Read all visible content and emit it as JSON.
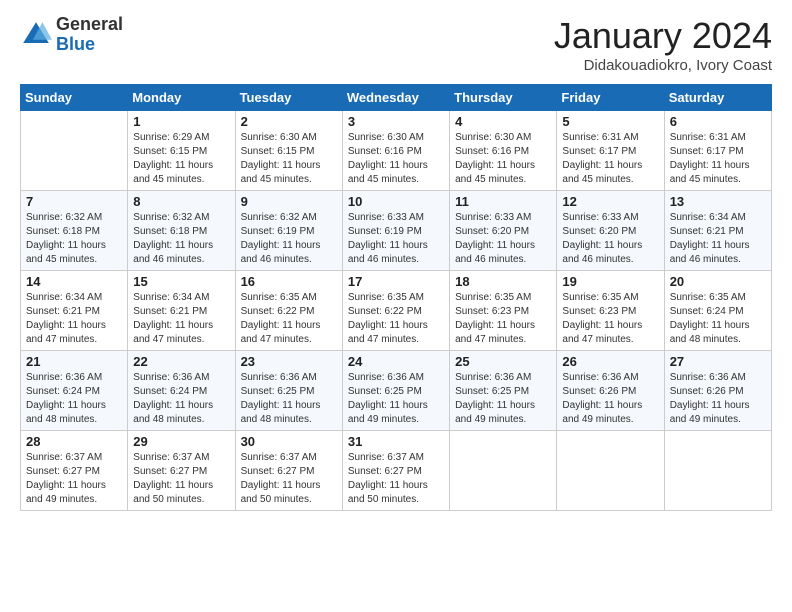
{
  "logo": {
    "general": "General",
    "blue": "Blue"
  },
  "header": {
    "month": "January 2024",
    "location": "Didakouadiokro, Ivory Coast"
  },
  "weekdays": [
    "Sunday",
    "Monday",
    "Tuesday",
    "Wednesday",
    "Thursday",
    "Friday",
    "Saturday"
  ],
  "weeks": [
    [
      {
        "day": "",
        "info": ""
      },
      {
        "day": "1",
        "info": "Sunrise: 6:29 AM\nSunset: 6:15 PM\nDaylight: 11 hours\nand 45 minutes."
      },
      {
        "day": "2",
        "info": "Sunrise: 6:30 AM\nSunset: 6:15 PM\nDaylight: 11 hours\nand 45 minutes."
      },
      {
        "day": "3",
        "info": "Sunrise: 6:30 AM\nSunset: 6:16 PM\nDaylight: 11 hours\nand 45 minutes."
      },
      {
        "day": "4",
        "info": "Sunrise: 6:30 AM\nSunset: 6:16 PM\nDaylight: 11 hours\nand 45 minutes."
      },
      {
        "day": "5",
        "info": "Sunrise: 6:31 AM\nSunset: 6:17 PM\nDaylight: 11 hours\nand 45 minutes."
      },
      {
        "day": "6",
        "info": "Sunrise: 6:31 AM\nSunset: 6:17 PM\nDaylight: 11 hours\nand 45 minutes."
      }
    ],
    [
      {
        "day": "7",
        "info": "Sunrise: 6:32 AM\nSunset: 6:18 PM\nDaylight: 11 hours\nand 45 minutes."
      },
      {
        "day": "8",
        "info": "Sunrise: 6:32 AM\nSunset: 6:18 PM\nDaylight: 11 hours\nand 46 minutes."
      },
      {
        "day": "9",
        "info": "Sunrise: 6:32 AM\nSunset: 6:19 PM\nDaylight: 11 hours\nand 46 minutes."
      },
      {
        "day": "10",
        "info": "Sunrise: 6:33 AM\nSunset: 6:19 PM\nDaylight: 11 hours\nand 46 minutes."
      },
      {
        "day": "11",
        "info": "Sunrise: 6:33 AM\nSunset: 6:20 PM\nDaylight: 11 hours\nand 46 minutes."
      },
      {
        "day": "12",
        "info": "Sunrise: 6:33 AM\nSunset: 6:20 PM\nDaylight: 11 hours\nand 46 minutes."
      },
      {
        "day": "13",
        "info": "Sunrise: 6:34 AM\nSunset: 6:21 PM\nDaylight: 11 hours\nand 46 minutes."
      }
    ],
    [
      {
        "day": "14",
        "info": "Sunrise: 6:34 AM\nSunset: 6:21 PM\nDaylight: 11 hours\nand 47 minutes."
      },
      {
        "day": "15",
        "info": "Sunrise: 6:34 AM\nSunset: 6:21 PM\nDaylight: 11 hours\nand 47 minutes."
      },
      {
        "day": "16",
        "info": "Sunrise: 6:35 AM\nSunset: 6:22 PM\nDaylight: 11 hours\nand 47 minutes."
      },
      {
        "day": "17",
        "info": "Sunrise: 6:35 AM\nSunset: 6:22 PM\nDaylight: 11 hours\nand 47 minutes."
      },
      {
        "day": "18",
        "info": "Sunrise: 6:35 AM\nSunset: 6:23 PM\nDaylight: 11 hours\nand 47 minutes."
      },
      {
        "day": "19",
        "info": "Sunrise: 6:35 AM\nSunset: 6:23 PM\nDaylight: 11 hours\nand 47 minutes."
      },
      {
        "day": "20",
        "info": "Sunrise: 6:35 AM\nSunset: 6:24 PM\nDaylight: 11 hours\nand 48 minutes."
      }
    ],
    [
      {
        "day": "21",
        "info": "Sunrise: 6:36 AM\nSunset: 6:24 PM\nDaylight: 11 hours\nand 48 minutes."
      },
      {
        "day": "22",
        "info": "Sunrise: 6:36 AM\nSunset: 6:24 PM\nDaylight: 11 hours\nand 48 minutes."
      },
      {
        "day": "23",
        "info": "Sunrise: 6:36 AM\nSunset: 6:25 PM\nDaylight: 11 hours\nand 48 minutes."
      },
      {
        "day": "24",
        "info": "Sunrise: 6:36 AM\nSunset: 6:25 PM\nDaylight: 11 hours\nand 49 minutes."
      },
      {
        "day": "25",
        "info": "Sunrise: 6:36 AM\nSunset: 6:25 PM\nDaylight: 11 hours\nand 49 minutes."
      },
      {
        "day": "26",
        "info": "Sunrise: 6:36 AM\nSunset: 6:26 PM\nDaylight: 11 hours\nand 49 minutes."
      },
      {
        "day": "27",
        "info": "Sunrise: 6:36 AM\nSunset: 6:26 PM\nDaylight: 11 hours\nand 49 minutes."
      }
    ],
    [
      {
        "day": "28",
        "info": "Sunrise: 6:37 AM\nSunset: 6:27 PM\nDaylight: 11 hours\nand 49 minutes."
      },
      {
        "day": "29",
        "info": "Sunrise: 6:37 AM\nSunset: 6:27 PM\nDaylight: 11 hours\nand 50 minutes."
      },
      {
        "day": "30",
        "info": "Sunrise: 6:37 AM\nSunset: 6:27 PM\nDaylight: 11 hours\nand 50 minutes."
      },
      {
        "day": "31",
        "info": "Sunrise: 6:37 AM\nSunset: 6:27 PM\nDaylight: 11 hours\nand 50 minutes."
      },
      {
        "day": "",
        "info": ""
      },
      {
        "day": "",
        "info": ""
      },
      {
        "day": "",
        "info": ""
      }
    ]
  ]
}
